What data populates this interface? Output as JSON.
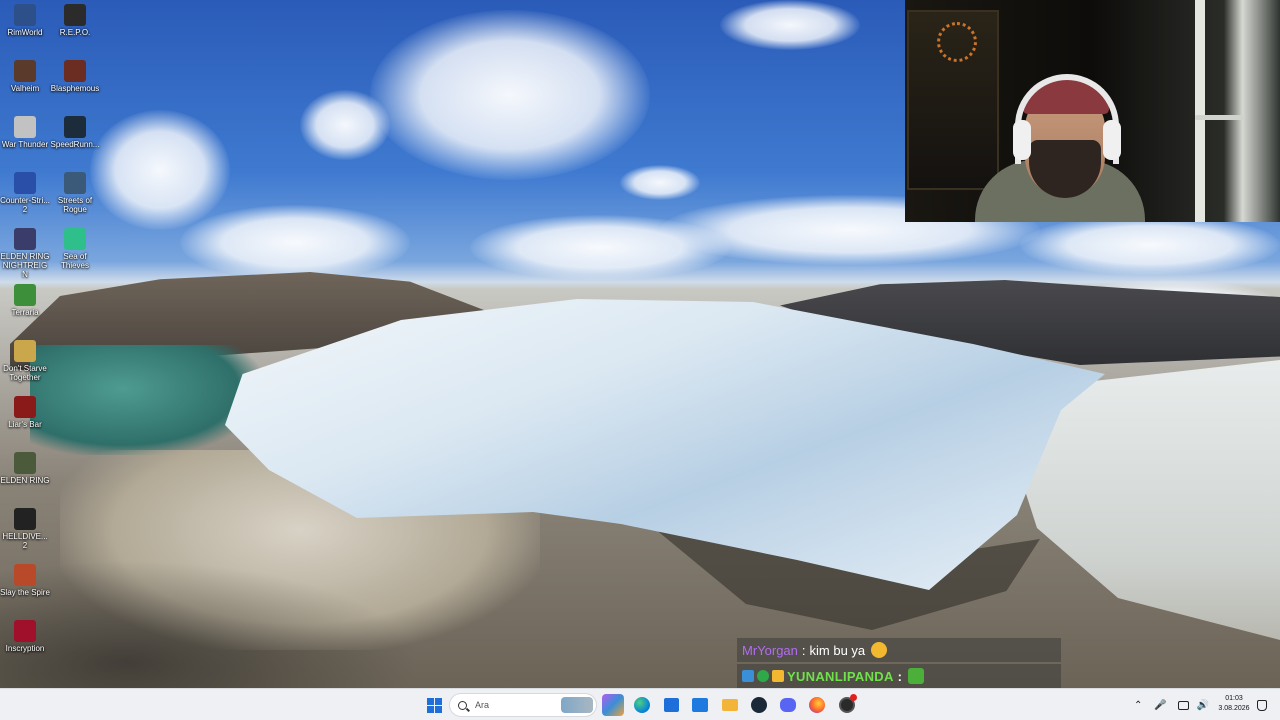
{
  "desktop": {
    "icons": [
      {
        "label": "RimWorld",
        "icon": "rimworld-icon",
        "color": "#2d4f8a"
      },
      {
        "label": "R.E.P.O.",
        "icon": "repo-icon",
        "color": "#2b2b2b"
      },
      {
        "label": "Valheim",
        "icon": "valheim-icon",
        "color": "#5a3a2a"
      },
      {
        "label": "Blasphemous",
        "icon": "blasphemous-icon",
        "color": "#6b2c22"
      },
      {
        "label": "War Thunder",
        "icon": "war-thunder-icon",
        "color": "#c2c2c2"
      },
      {
        "label": "SpeedRunn...",
        "icon": "speedrunners-icon",
        "color": "#1d2c3a"
      },
      {
        "label": "Counter-Stri... 2",
        "icon": "counter-strike-icon",
        "color": "#2a4fa8"
      },
      {
        "label": "Streets of Rogue",
        "icon": "streets-of-rogue-icon",
        "color": "#3b5a7a"
      },
      {
        "label": "ELDEN RING NIGHTREIGN",
        "icon": "elden-ring-nightreign-icon",
        "color": "#3a3d6a"
      },
      {
        "label": "Sea of Thieves",
        "icon": "sea-of-thieves-icon",
        "color": "#2fbf8a"
      },
      {
        "label": "Terraria",
        "icon": "terraria-icon",
        "color": "#3e8f3a"
      },
      {
        "label": "Don't Starve Together",
        "icon": "dont-starve-together-icon",
        "color": "#c9a74a"
      },
      {
        "label": "Liar's Bar",
        "icon": "liars-bar-icon",
        "color": "#8a1a1a"
      },
      {
        "label": "ELDEN RING",
        "icon": "elden-ring-icon",
        "color": "#4a5a3a"
      },
      {
        "label": "HELLDIVE... 2",
        "icon": "helldivers-icon",
        "color": "#222222"
      },
      {
        "label": "Slay the Spire",
        "icon": "slay-the-spire-icon",
        "color": "#b84a2a"
      },
      {
        "label": "Inscryption",
        "icon": "inscryption-icon",
        "color": "#a0102a"
      }
    ]
  },
  "chat": {
    "messages": [
      {
        "user": "MrYorgan",
        "separator": ":",
        "text": "kim bu ya",
        "emote": "smug-emote",
        "user_color": "#b36cf0"
      },
      {
        "user": "YUNANLIPANDA",
        "separator": ":",
        "text": "",
        "emote": "pepe-emote",
        "user_color": "#6fe24a"
      }
    ]
  },
  "taskbar": {
    "search_placeholder": "Ara",
    "apps": [
      {
        "name": "start-button",
        "icon": "windows-icon"
      },
      {
        "name": "copilot",
        "icon": "copilot-icon",
        "color": "#b45cf0"
      },
      {
        "name": "edge",
        "icon": "edge-icon",
        "color": "#0c8ad6"
      },
      {
        "name": "store",
        "icon": "store-icon",
        "color": "#1e6fd9"
      },
      {
        "name": "outlook",
        "icon": "outlook-icon",
        "color": "#1f7ae0"
      },
      {
        "name": "file-explorer",
        "icon": "folder-icon",
        "color": "#f2b53a"
      },
      {
        "name": "steam",
        "icon": "steam-icon",
        "color": "#1b2838"
      },
      {
        "name": "discord",
        "icon": "discord-icon",
        "color": "#5865f2"
      },
      {
        "name": "firefox",
        "icon": "firefox-icon",
        "color": "#ff6a2a"
      },
      {
        "name": "obs",
        "icon": "obs-recording-icon",
        "color": "#2a2a2a"
      }
    ],
    "tray": {
      "time": "01:03",
      "date": "3.08.2026"
    }
  }
}
